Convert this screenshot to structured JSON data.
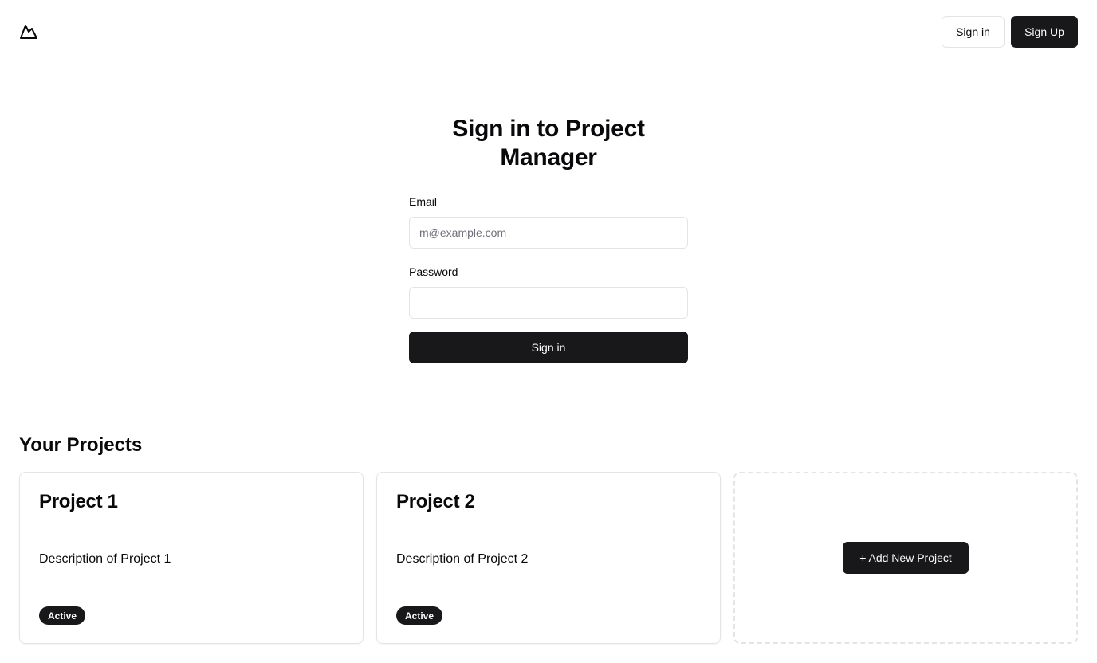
{
  "header": {
    "logo_icon": "mountain-icon",
    "signin_label": "Sign in",
    "signup_label": "Sign Up"
  },
  "signin_form": {
    "title": "Sign in to Project Manager",
    "email_label": "Email",
    "email_placeholder": "m@example.com",
    "email_value": "",
    "password_label": "Password",
    "password_value": "",
    "submit_label": "Sign in"
  },
  "projects": {
    "heading": "Your Projects",
    "items": [
      {
        "title": "Project 1",
        "description": "Description of Project 1",
        "status": "Active"
      },
      {
        "title": "Project 2",
        "description": "Description of Project 2",
        "status": "Active"
      }
    ],
    "add_label": "+ Add New Project"
  },
  "colors": {
    "primary": "#18181b",
    "primary_text": "#fafafa",
    "border": "#e4e4e7",
    "muted_text": "#71717a"
  }
}
